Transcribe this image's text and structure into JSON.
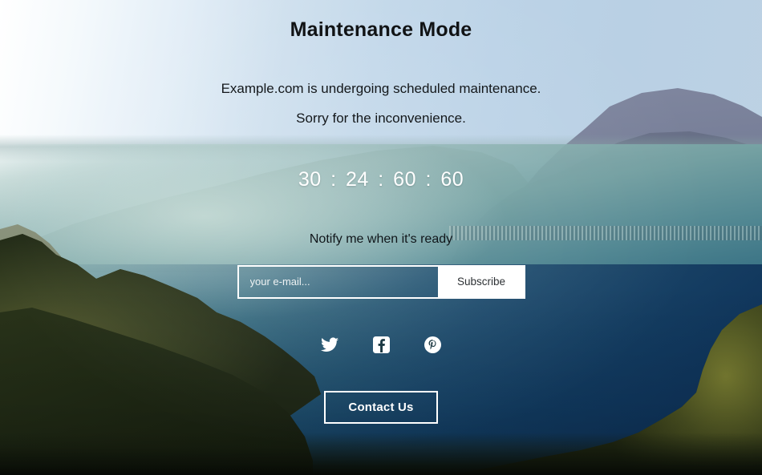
{
  "page": {
    "title": "Maintenance Mode",
    "intro_line_1": "Example.com is undergoing scheduled maintenance.",
    "intro_line_2": "Sorry for the inconvenience."
  },
  "countdown": {
    "days": "30",
    "hours": "24",
    "minutes": "60",
    "seconds": "60",
    "separator": ":"
  },
  "notify": {
    "label": "Notify me when it's ready",
    "email_placeholder": "your e-mail...",
    "email_value": "",
    "subscribe_label": "Subscribe"
  },
  "social": [
    {
      "name": "twitter",
      "title": "Twitter"
    },
    {
      "name": "facebook",
      "title": "Facebook"
    },
    {
      "name": "pinterest",
      "title": "Pinterest"
    }
  ],
  "contact": {
    "label": "Contact Us"
  },
  "colors": {
    "title_text": "#111315",
    "body_text": "#14181b",
    "countdown_text": "#ffffff",
    "accent_white": "#ffffff",
    "button_text": "#2d3134"
  },
  "background": {
    "description": "lake-and-mountains-photo"
  }
}
